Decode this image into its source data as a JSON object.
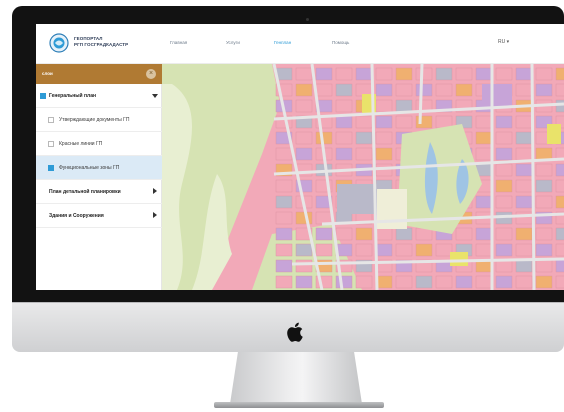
{
  "app": {
    "logo_line1": "ГЕОПОРТАЛ",
    "logo_line2": "РГП ГОСГРАДКАДАСТР"
  },
  "nav": {
    "items": [
      {
        "label": "Главная",
        "active": false
      },
      {
        "label": "Услуги",
        "active": false
      },
      {
        "label": "Генплан",
        "active": true
      },
      {
        "label": "Помощь",
        "active": false
      }
    ],
    "language": "RU ▾"
  },
  "sidebar": {
    "title": "слои",
    "close_symbol": "×",
    "items": [
      {
        "label": "Генеральный план",
        "checkbox": true,
        "checked": true,
        "bold": true,
        "expander": "down",
        "indent": false,
        "selected": false
      },
      {
        "label": "Утверждающие документы ГП",
        "checkbox": true,
        "checked": false,
        "bold": false,
        "expander": "",
        "indent": true,
        "selected": false
      },
      {
        "label": "Красные линии ГП",
        "checkbox": true,
        "checked": false,
        "bold": false,
        "expander": "",
        "indent": true,
        "selected": false
      },
      {
        "label": "Функциональные зоны ГП",
        "checkbox": true,
        "checked": true,
        "bold": false,
        "expander": "",
        "indent": true,
        "selected": true
      },
      {
        "label": "План детальной планировки",
        "checkbox": false,
        "checked": false,
        "bold": true,
        "expander": "right",
        "indent": false,
        "selected": false
      },
      {
        "label": "Здания и Сооружения",
        "checkbox": false,
        "checked": false,
        "bold": true,
        "expander": "right",
        "indent": false,
        "selected": false
      }
    ]
  },
  "map": {
    "colors": {
      "residential": "#f2a9b8",
      "public": "#c7a4d8",
      "industrial": "#b9b9c9",
      "green": "#d6e3b3",
      "park_light": "#e8efd2",
      "water": "#9fc4e4",
      "road": "#e6e6e6",
      "yellow": "#e9e36a",
      "orange": "#f0b070"
    }
  },
  "device": {
    "brand_icon": "apple-logo-icon"
  }
}
